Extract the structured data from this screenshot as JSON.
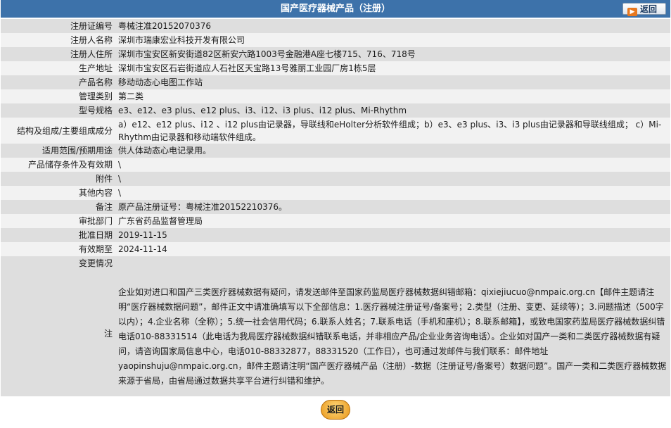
{
  "header": {
    "title": "国产医疗器械产品（注册）",
    "back_label": "返回"
  },
  "rows": [
    {
      "label": "注册证编号",
      "value": "粤械注准20152070376"
    },
    {
      "label": "注册人名称",
      "value": "深圳市瑞康宏业科技开发有限公司"
    },
    {
      "label": "注册人住所",
      "value": "深圳市宝安区新安街道82区新安六路1003号金融港A座七楼715、716、718号"
    },
    {
      "label": "生产地址",
      "value": "深圳市宝安区石岩街道应人石社区天宝路13号雅丽工业园厂房1栋5层"
    },
    {
      "label": "产品名称",
      "value": "移动动态心电图工作站"
    },
    {
      "label": "管理类别",
      "value": "第二类"
    },
    {
      "label": "型号规格",
      "value": "e3、e12、e3 plus、e12 plus、i3、i12、i3 plus、i12 plus、Mi-Rhythm"
    },
    {
      "label": "结构及组成/主要组成成分",
      "value": "a）e12、e12 plus、i12 、i12 plus由记录器，导联线和eHolter分析软件组成；b）e3、e3 plus、i3、i3 plus由记录器和导联线组成； c）Mi-Rhythm由记录器和移动端软件组成。"
    },
    {
      "label": "适用范围/预期用途",
      "value": "供人体动态心电记录用。"
    },
    {
      "label": "产品储存条件及有效期",
      "value": "\\"
    },
    {
      "label": "附件",
      "value": "\\"
    },
    {
      "label": "其他内容",
      "value": "\\"
    },
    {
      "label": "备注",
      "value": "原产品注册证号：粤械注准20152210376。"
    },
    {
      "label": "审批部门",
      "value": "广东省药品监督管理局"
    },
    {
      "label": "批准日期",
      "value": "2019-11-15"
    },
    {
      "label": "有效期至",
      "value": "2024-11-14"
    },
    {
      "label": "变更情况",
      "value": ""
    }
  ],
  "note": {
    "label": "注",
    "text": "企业如对进口和国产三类医疗器械数据有疑问，请发送邮件至国家药监局医疗器械数据纠错邮箱：qixiejiucuo@nmpaic.org.cn【邮件主题请注明“医疗器械数据问题”，邮件正文中请准确填写以下全部信息：1.医疗器械注册证号/备案号；2.类型（注册、变更、延续等）；3.问题描述（500字以内）；4.企业名称（全称）；5.统一社会信用代码；6.联系人姓名；7.联系电话（手机和座机）；8.联系邮箱】，或致电国家药监局医疗器械数据纠错电话010-88331514（此电话为我局医疗器械数据纠错联系电话，并非相应产品/企业业务咨询电话）。企业如对国产一类和二类医疗器械数据有疑问，请咨询国家局信息中心，电话010-88332877，88331520（工作日），也可通过发邮件与我们联系：邮件地址yaopinshuju@nmpaic.org.cn，邮件主题请注明“国产医疗器械产品（注册）-数据（注册证号/备案号）数据问题”。国产一类和二类医疗器械数据来源于省局，由省局通过数据共享平台进行纠错和维护。"
  },
  "footer": {
    "back_label": "返回"
  },
  "colors": {
    "header_bg": "#3d72aa",
    "row_odd": "#dedede",
    "row_even": "#f2f2f2",
    "button_orange": "#e8961a"
  }
}
